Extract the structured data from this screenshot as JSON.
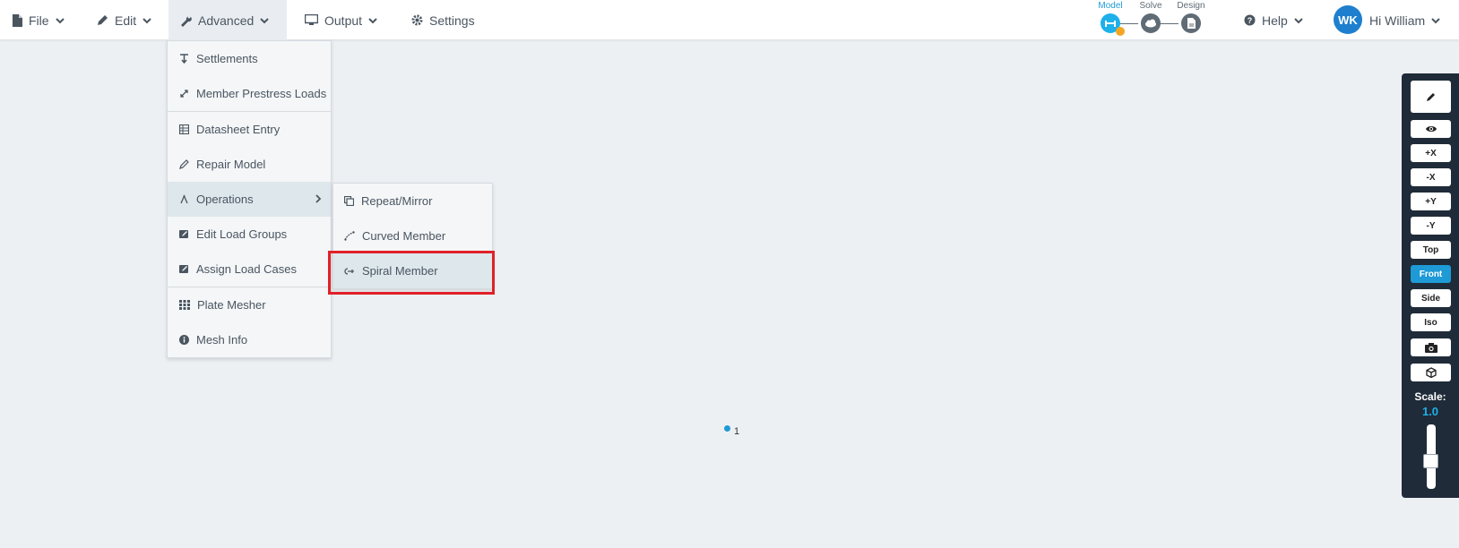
{
  "nav": {
    "file": "File",
    "edit": "Edit",
    "advanced": "Advanced",
    "output": "Output",
    "settings": "Settings",
    "help": "Help"
  },
  "stepper": {
    "model": "Model",
    "solve": "Solve",
    "design": "Design"
  },
  "user": {
    "initials": "WK",
    "greeting": "Hi William"
  },
  "advanced_menu": {
    "items": [
      {
        "label": "Settlements"
      },
      {
        "label": "Member Prestress Loads"
      },
      {
        "label": "Datasheet Entry"
      },
      {
        "label": "Repair Model"
      },
      {
        "label": "Operations"
      },
      {
        "label": "Edit Load Groups"
      },
      {
        "label": "Assign Load Cases"
      },
      {
        "label": "Plate Mesher"
      },
      {
        "label": "Mesh Info"
      }
    ]
  },
  "operations_submenu": {
    "items": [
      {
        "label": "Repeat/Mirror"
      },
      {
        "label": "Curved Member"
      },
      {
        "label": "Spiral Member"
      }
    ]
  },
  "canvas": {
    "node_label": "1"
  },
  "toolbar": {
    "plus_x": "+X",
    "minus_x": "-X",
    "plus_y": "+Y",
    "minus_y": "-Y",
    "top": "Top",
    "front": "Front",
    "side": "Side",
    "iso": "Iso",
    "scale_label": "Scale:",
    "scale_value": "1.0"
  },
  "colors": {
    "accent": "#1e9ad6",
    "highlight": "#e02129",
    "toolbar_bg": "#1f2b38",
    "warning": "#f4a623"
  }
}
